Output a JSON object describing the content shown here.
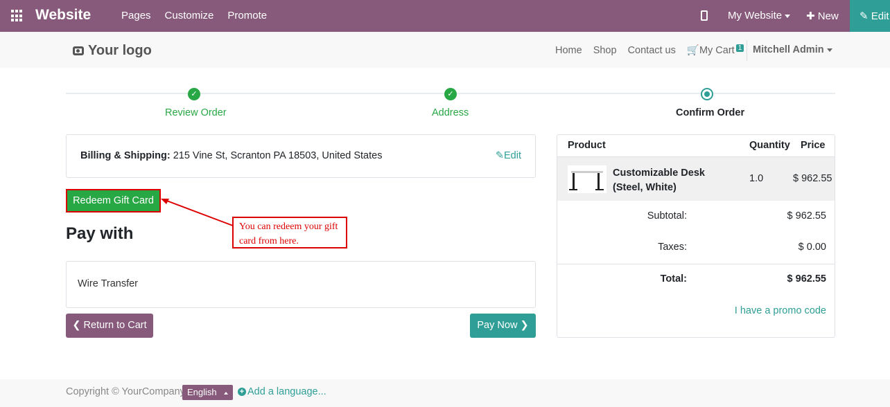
{
  "topbar": {
    "brand": "Website",
    "menu": [
      "Pages",
      "Customize",
      "Promote"
    ],
    "site_selector": "My Website",
    "new_label": "New",
    "edit_label": "Edit"
  },
  "header": {
    "logo_text": "Your logo",
    "nav": [
      "Home",
      "Shop",
      "Contact us"
    ],
    "cart_label": "My Cart",
    "cart_count": "1",
    "user_name": "Mitchell Admin"
  },
  "wizard": {
    "steps": [
      {
        "label": "Review Order",
        "state": "done"
      },
      {
        "label": "Address",
        "state": "done"
      },
      {
        "label": "Confirm Order",
        "state": "current"
      }
    ]
  },
  "billing": {
    "label": "Billing & Shipping:",
    "address": "215 Vine St, Scranton PA 18503, United States",
    "edit_label": "Edit"
  },
  "redeem_label": "Redeem Gift Card",
  "annotation": {
    "line1": "You can redeem your gift",
    "line2": "card from here."
  },
  "pay_title": "Pay with",
  "payment_method": "Wire Transfer",
  "buttons": {
    "return_label": "Return to Cart",
    "pay_label": "Pay Now"
  },
  "summary": {
    "headers": {
      "product": "Product",
      "quantity": "Quantity",
      "price": "Price"
    },
    "product": {
      "name": "Customizable Desk (Steel, White)",
      "quantity": "1.0",
      "price": "$ 962.55"
    },
    "subtotal_label": "Subtotal:",
    "subtotal": "$ 962.55",
    "taxes_label": "Taxes:",
    "taxes": "$ 0.00",
    "total_label": "Total:",
    "total": "$ 962.55",
    "promo_label": "I have a promo code"
  },
  "footer": {
    "copyright": "Copyright © YourCompany",
    "language": "English",
    "add_language": "Add a language..."
  },
  "colors": {
    "brand": "#875a7b",
    "accent": "#2e9e96",
    "success": "#28a745",
    "annotation": "#dd0000"
  }
}
